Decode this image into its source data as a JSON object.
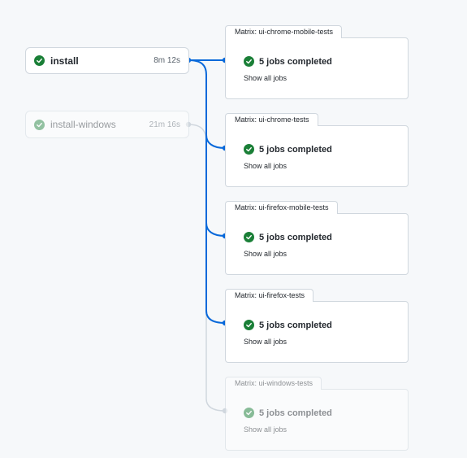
{
  "colors": {
    "success": "#1a7f37",
    "edge_active": "#0969da",
    "edge_inactive": "#d0d7de"
  },
  "jobs": [
    {
      "name": "install",
      "duration": "8m 12s",
      "status_icon": "check-circle-icon",
      "active": true
    },
    {
      "name": "install-windows",
      "duration": "21m 16s",
      "status_icon": "check-circle-icon",
      "active": false
    }
  ],
  "matrices": [
    {
      "label": "Matrix: ui-chrome-mobile-tests",
      "summary": "5 jobs completed",
      "link": "Show all jobs",
      "active": true
    },
    {
      "label": "Matrix: ui-chrome-tests",
      "summary": "5 jobs completed",
      "link": "Show all jobs",
      "active": true
    },
    {
      "label": "Matrix: ui-firefox-mobile-tests",
      "summary": "5 jobs completed",
      "link": "Show all jobs",
      "active": true
    },
    {
      "label": "Matrix: ui-firefox-tests",
      "summary": "5 jobs completed",
      "link": "Show all jobs",
      "active": true
    },
    {
      "label": "Matrix: ui-windows-tests",
      "summary": "5 jobs completed",
      "link": "Show all jobs",
      "active": false
    }
  ]
}
